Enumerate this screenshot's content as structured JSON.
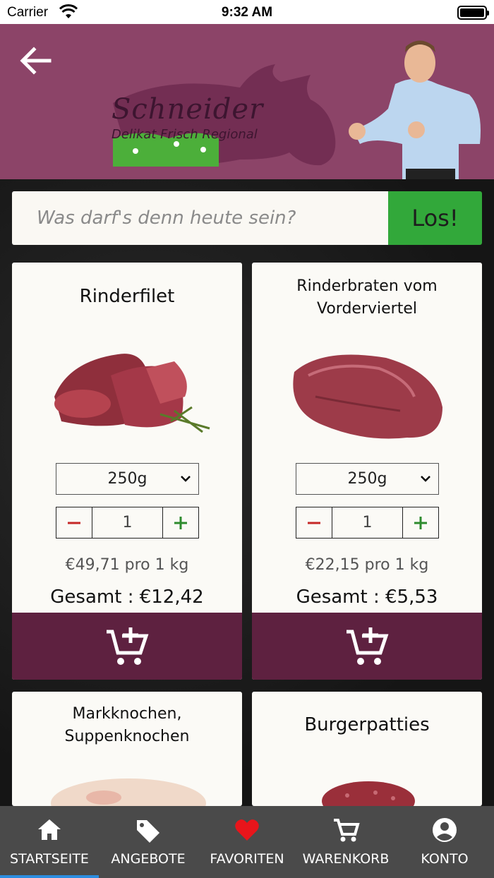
{
  "status_bar": {
    "carrier": "Carrier",
    "time": "9:32 AM"
  },
  "header": {
    "logo_title": "Schneider",
    "logo_subtitle": "Delikat Frisch Regional",
    "brand_color": "#8c4468"
  },
  "search": {
    "placeholder": "Was darf's denn heute sein?",
    "button_label": "Los!",
    "button_color": "#32a83a"
  },
  "products": [
    {
      "title": "Rinderfilet",
      "weight": "250g",
      "quantity": "1",
      "unit_price": "€49,71 pro 1 kg",
      "total": "Gesamt : €12,42"
    },
    {
      "title": "Rinderbraten vom Vorderviertel",
      "weight": "250g",
      "quantity": "1",
      "unit_price": "€22,15 pro 1 kg",
      "total": "Gesamt : €5,53"
    },
    {
      "title": "Markknochen, Suppenknochen"
    },
    {
      "title": "Burgerpatties"
    }
  ],
  "cart_button_color": "#5e2140",
  "tabbar": {
    "items": [
      {
        "label": "STARTSEITE",
        "icon": "home-icon"
      },
      {
        "label": "ANGEBOTE",
        "icon": "tag-icon"
      },
      {
        "label": "FAVORITEN",
        "icon": "heart-icon"
      },
      {
        "label": "WARENKORB",
        "icon": "cart-icon"
      },
      {
        "label": "KONTO",
        "icon": "account-icon"
      }
    ],
    "active_index": 0,
    "active_color": "#2c8de0"
  }
}
